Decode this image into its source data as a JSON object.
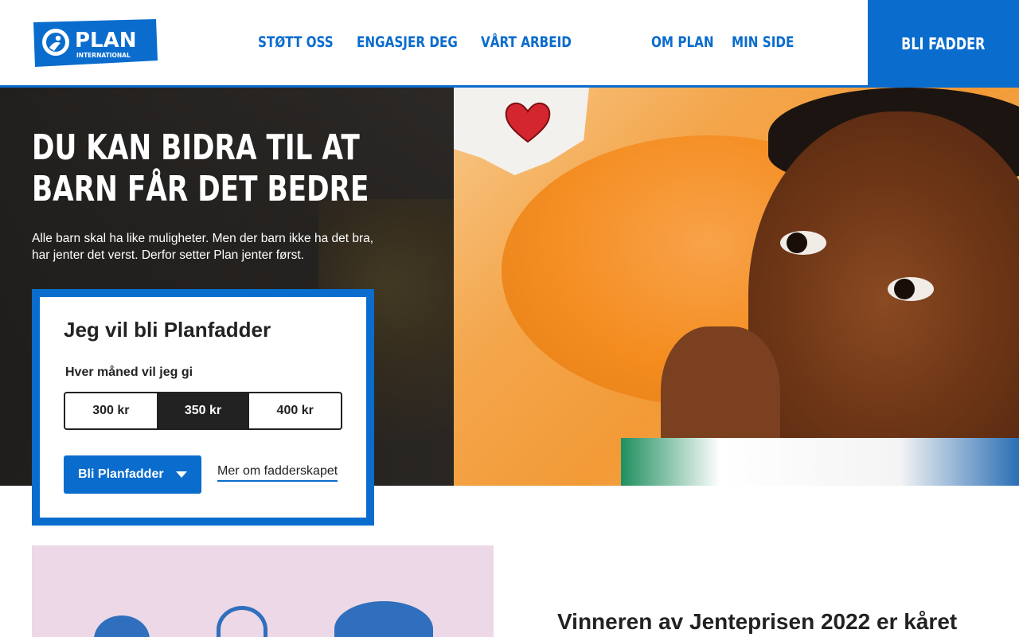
{
  "header": {
    "logo": {
      "name": "PLAN",
      "subtitle": "INTERNATIONAL"
    },
    "nav": [
      {
        "label": "STØTT OSS"
      },
      {
        "label": "ENGASJER DEG"
      },
      {
        "label": "VÅRT ARBEID"
      },
      {
        "label": "OM PLAN"
      },
      {
        "label": "MIN SIDE"
      }
    ],
    "cta_label": "BLI FADDER"
  },
  "hero": {
    "title_line1": "DU KAN BIDRA TIL AT",
    "title_line2": "BARN FÅR DET BEDRE",
    "subtitle": "Alle barn skal ha like muligheter. Men der barn ikke ha det bra, har jenter det verst. Derfor setter Plan jenter først."
  },
  "donation_card": {
    "title": "Jeg vil bli Planfadder",
    "label": "Hver måned vil jeg gi",
    "amounts": [
      {
        "label": "300 kr",
        "selected": false
      },
      {
        "label": "350 kr",
        "selected": true
      },
      {
        "label": "400 kr",
        "selected": false
      }
    ],
    "primary_button": "Bli Planfadder",
    "secondary_link": "Mer om fadderskapet"
  },
  "promo": {
    "title": "Vinneren av Jenteprisen 2022 er kåret"
  },
  "colors": {
    "brand_blue": "#0a6ccd",
    "dark": "#222222",
    "promo_bg": "#ecd8e6"
  }
}
